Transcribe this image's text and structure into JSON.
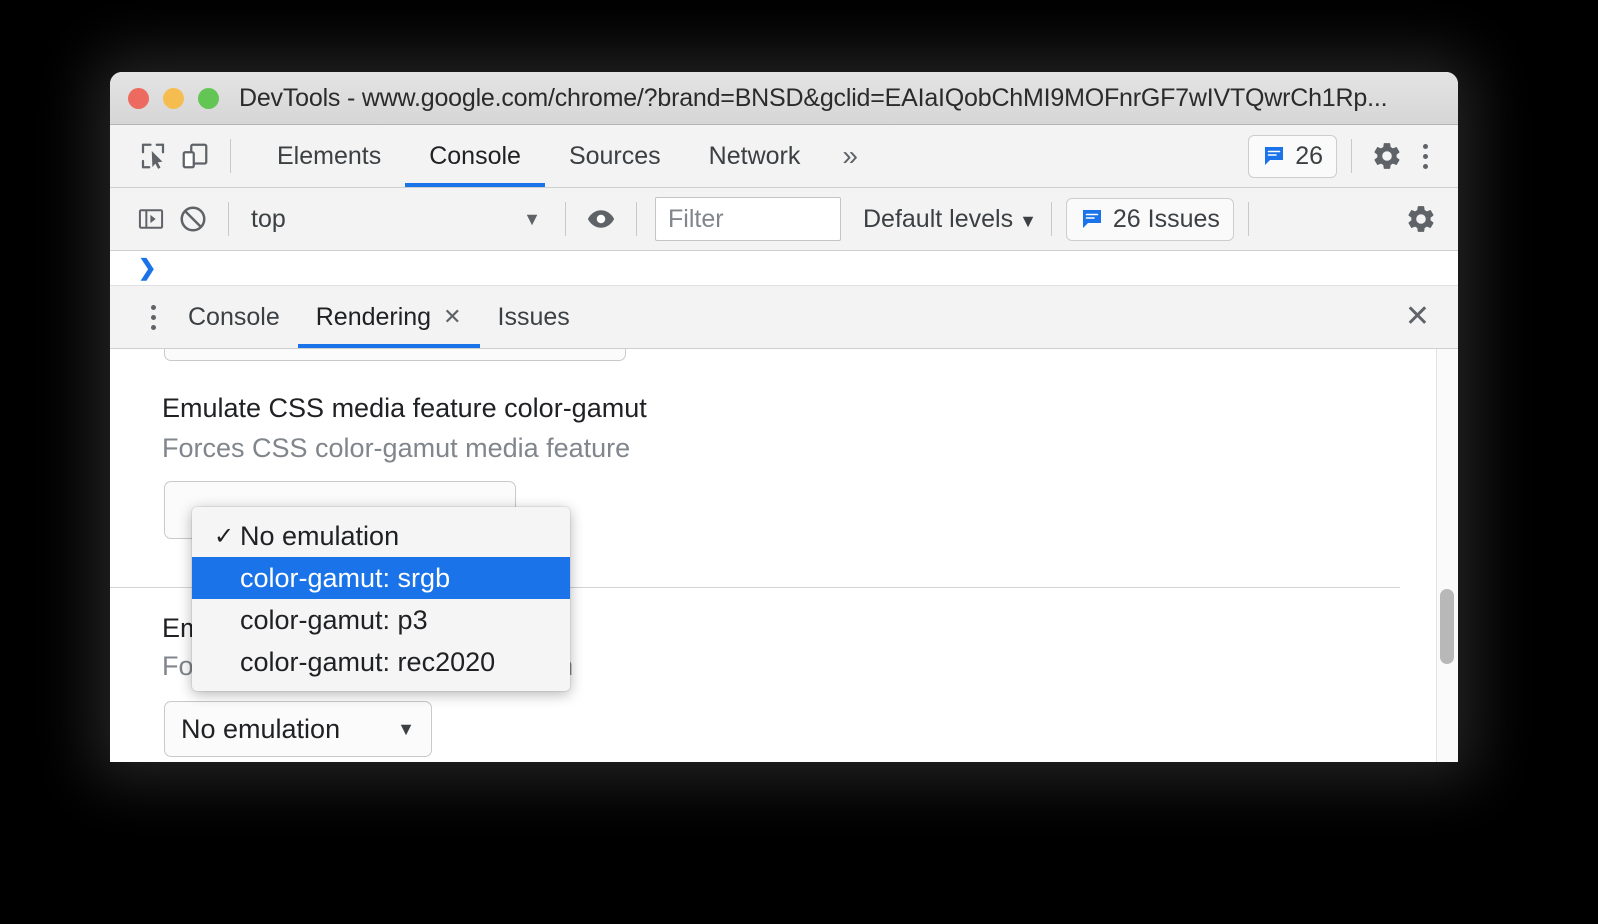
{
  "window": {
    "title": "DevTools - www.google.com/chrome/?brand=BNSD&gclid=EAIaIQobChMI9MOFnrGF7wIVTQwrCh1Rp...",
    "traffic_lights": {
      "close": "close-window",
      "minimize": "minimize-window",
      "maximize": "maximize-window"
    }
  },
  "devtools_tabbar": {
    "inspect_icon": "inspect-element-icon",
    "device_toolbar_icon": "device-toolbar-icon",
    "tabs": [
      {
        "label": "Elements",
        "active": false
      },
      {
        "label": "Console",
        "active": true
      },
      {
        "label": "Sources",
        "active": false
      },
      {
        "label": "Network",
        "active": false
      }
    ],
    "more_tabs": "»",
    "issues_count": "26",
    "issues_icon": "issues-bubble-icon",
    "settings_icon": "gear-icon",
    "more_options_icon": "kebab-menu-icon"
  },
  "console_toolbar": {
    "sidebar_toggle_icon": "console-sidebar-icon",
    "clear_icon": "clear-console-icon",
    "context": "top",
    "context_caret": "▼",
    "eye_icon": "live-expression-eye-icon",
    "filter_placeholder": "Filter",
    "filter_value": "",
    "levels_label": "Default levels",
    "levels_caret": "▼",
    "issues_badge": "26 Issues",
    "issues_badge_icon": "issues-bubble-icon",
    "settings_icon": "gear-icon"
  },
  "console_prompt": {
    "chevron": "❯"
  },
  "drawer": {
    "menu_icon": "kebab-menu-icon",
    "tabs": [
      {
        "label": "Console",
        "active": false,
        "closable": false
      },
      {
        "label": "Rendering",
        "active": true,
        "closable": true,
        "close_glyph": "✕"
      },
      {
        "label": "Issues",
        "active": false,
        "closable": false
      }
    ],
    "close_glyph": "✕"
  },
  "rendering": {
    "color_gamut": {
      "title": "Emulate CSS media feature color-gamut",
      "description": "Forces CSS color-gamut media feature",
      "selected_value": "No emulation"
    },
    "vision_deficiency": {
      "title": "Emulate vision deficiencies",
      "description": "Forces vision deficiency emulation",
      "selected_value": "No emulation",
      "caret": "▼"
    }
  },
  "dropdown": {
    "items": [
      {
        "label": "No emulation",
        "checked": true,
        "highlighted": false,
        "check_glyph": "✓"
      },
      {
        "label": "color-gamut: srgb",
        "checked": false,
        "highlighted": true,
        "check_glyph": ""
      },
      {
        "label": "color-gamut: p3",
        "checked": false,
        "highlighted": false,
        "check_glyph": ""
      },
      {
        "label": "color-gamut: rec2020",
        "checked": false,
        "highlighted": false,
        "check_glyph": ""
      }
    ]
  },
  "colors": {
    "accent": "#1a73e8",
    "traffic_red": "#ec6a5f",
    "traffic_yellow": "#f5bd4f",
    "traffic_green": "#62c554",
    "toolbar_bg": "#f3f3f3",
    "text": "#3c4043",
    "muted_text": "#80868b"
  }
}
